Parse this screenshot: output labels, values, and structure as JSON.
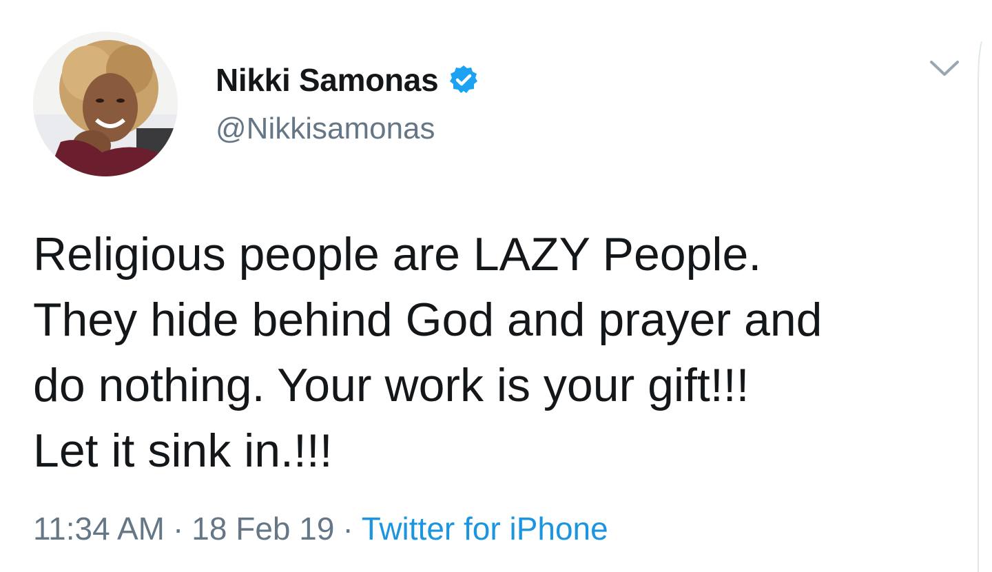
{
  "tweet": {
    "author": {
      "display_name": "Nikki Samonas",
      "handle": "@Nikkisamonas",
      "verified_icon": "verified-badge-icon"
    },
    "text_lines": [
      "Religious people are LAZY People.",
      "They hide behind God and prayer and",
      "do nothing. Your work is your gift!!!",
      "Let it sink in.!!!"
    ],
    "time": "11:34 AM",
    "date": "18 Feb 19",
    "separator": "·",
    "source": "Twitter for iPhone"
  },
  "icons": {
    "menu": "chevron-down-icon"
  },
  "colors": {
    "text": "#14171a",
    "secondary": "#657786",
    "link": "#1b95e0",
    "verified": "#1da1f2"
  }
}
